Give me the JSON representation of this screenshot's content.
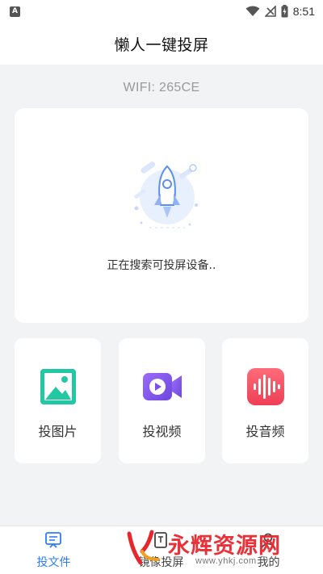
{
  "status_bar": {
    "time": "8:51",
    "left_icon": "A",
    "icons": [
      "wifi-icon",
      "no-signal-icon",
      "battery-charging-icon"
    ]
  },
  "header": {
    "title": "懒人一键投屏"
  },
  "wifi": {
    "label": "WIFI: 265CE"
  },
  "search_card": {
    "status_text": "正在搜索可投屏设备..",
    "illustration": "rocket-icon"
  },
  "features": [
    {
      "label": "投图片",
      "icon": "image-icon",
      "color": "#22c7a3"
    },
    {
      "label": "投视频",
      "icon": "video-icon",
      "color": "#8a5cf0"
    },
    {
      "label": "投音频",
      "icon": "audio-wave-icon",
      "color": "#f24c5e"
    }
  ],
  "bottom_nav": {
    "items": [
      {
        "label": "投文件",
        "icon": "file-cast-icon",
        "active": true
      },
      {
        "label": "镜像投屏",
        "icon": "mirror-cast-icon",
        "active": false
      },
      {
        "label": "我的",
        "icon": "profile-icon",
        "active": false
      }
    ]
  },
  "watermark": {
    "text": "永辉资源网",
    "url": "www.yhkj.com"
  },
  "colors": {
    "accent": "#2f7df6",
    "background": "#f2f3f5"
  }
}
